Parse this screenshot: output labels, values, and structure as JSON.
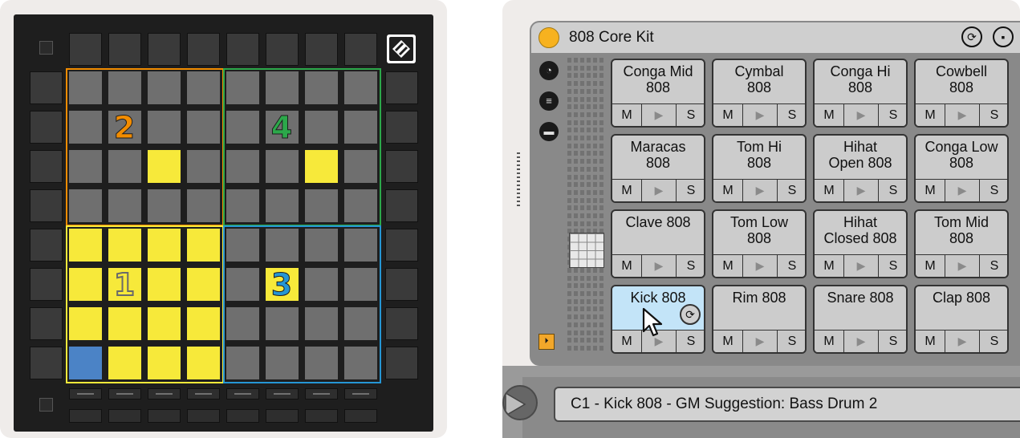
{
  "launchpad": {
    "quadrant_labels": [
      "1",
      "2",
      "3",
      "4"
    ],
    "colors": {
      "grid": "#6f6f6f",
      "yellow": "#f7e93a",
      "blue": "#4b83c6",
      "q1": "#f7e93a",
      "q2": "#f28c00",
      "q3": "#2596d4",
      "q4": "#2ca84a"
    },
    "logo_icon": "launchpad-logo-icon"
  },
  "drum_rack": {
    "title": "808 Core Kit",
    "header_icons": [
      "hot-swap-icon",
      "save-preset-icon"
    ],
    "side_icons": [
      "macro-dial-icon",
      "chain-list-icon",
      "io-icon"
    ],
    "chain_toggle_icon": "chain-toggle-icon",
    "pad_controls": {
      "mute": "M",
      "play": "▶",
      "solo": "S"
    },
    "pads": [
      [
        "Conga Mid\n808",
        "Cymbal\n808",
        "Conga Hi\n808",
        "Cowbell\n808"
      ],
      [
        "Maracas\n808",
        "Tom Hi\n808",
        "Hihat\nOpen 808",
        "Conga Low\n808"
      ],
      [
        "Clave 808",
        "Tom Low\n808",
        "Hihat\nClosed 808",
        "Tom Mid\n808"
      ],
      [
        "Kick 808",
        "Rim 808",
        "Snare 808",
        "Clap 808"
      ]
    ],
    "selected_pad": "Kick 808",
    "status_text": "C1 - Kick 808 - GM Suggestion: Bass Drum 2"
  }
}
